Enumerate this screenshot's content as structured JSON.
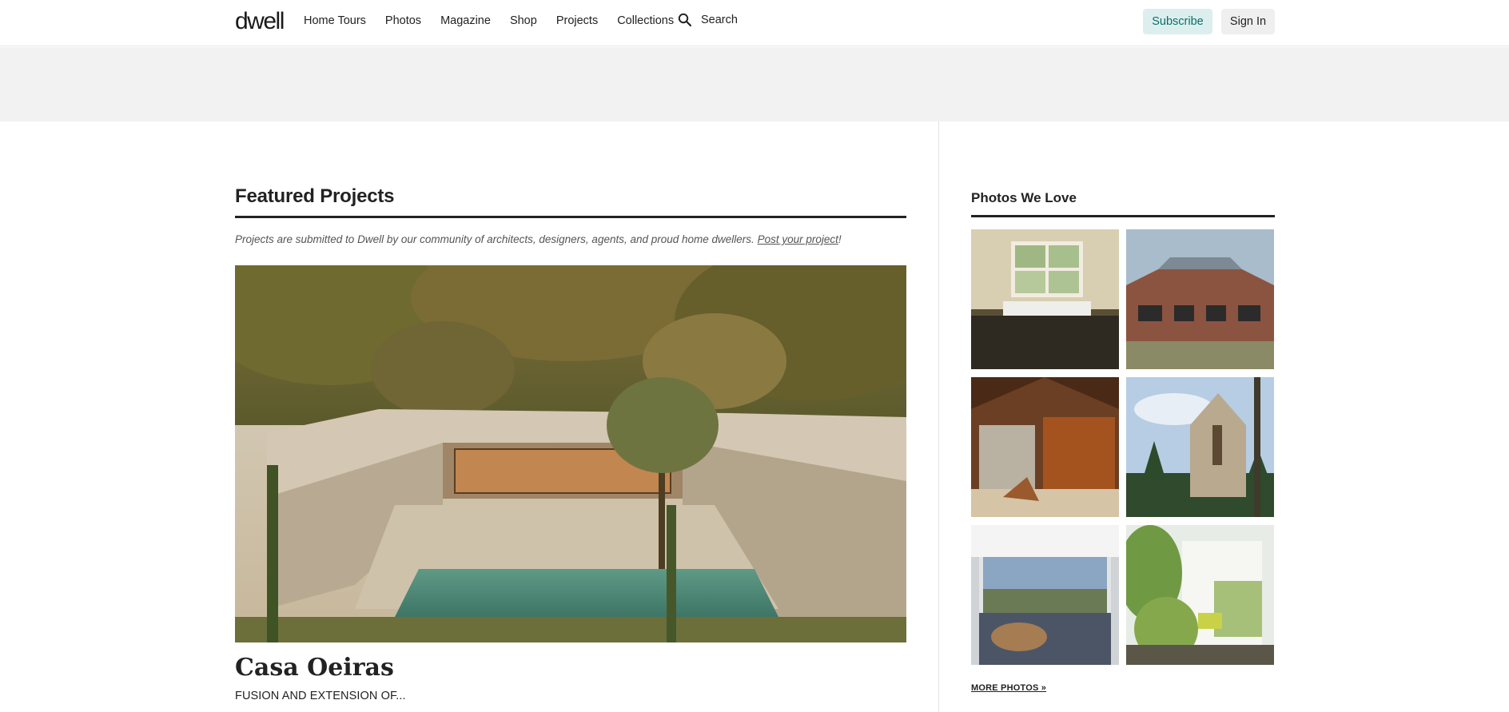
{
  "header": {
    "logo": "dwell",
    "nav": [
      "Home Tours",
      "Photos",
      "Magazine",
      "Shop",
      "Projects",
      "Collections"
    ],
    "search_label": "Search",
    "subscribe_label": "Subscribe",
    "signin_label": "Sign In"
  },
  "featured": {
    "title": "Featured Projects",
    "intro_text": "Projects are submitted to Dwell by our community of architects, designers, agents, and proud home dwellers. ",
    "intro_link": "Post your project",
    "intro_end": "!",
    "project": {
      "title": "Casa Oeiras",
      "subtitle": "FUSION AND EXTENSION OF..."
    }
  },
  "photos": {
    "title": "Photos We Love",
    "more_label": "MORE PHOTOS »",
    "items": [
      {
        "name": "kitchen-sink-photo"
      },
      {
        "name": "brick-building-photo"
      },
      {
        "name": "wood-interior-photo"
      },
      {
        "name": "forest-cabin-photo"
      },
      {
        "name": "porch-tub-photo"
      },
      {
        "name": "greenery-doorway-photo"
      }
    ]
  },
  "colors": {
    "accent": "#0b6f6a",
    "subscribe_bg": "#dcefee",
    "signin_bg": "#efefef",
    "ad_band": "#f2f2f2"
  }
}
